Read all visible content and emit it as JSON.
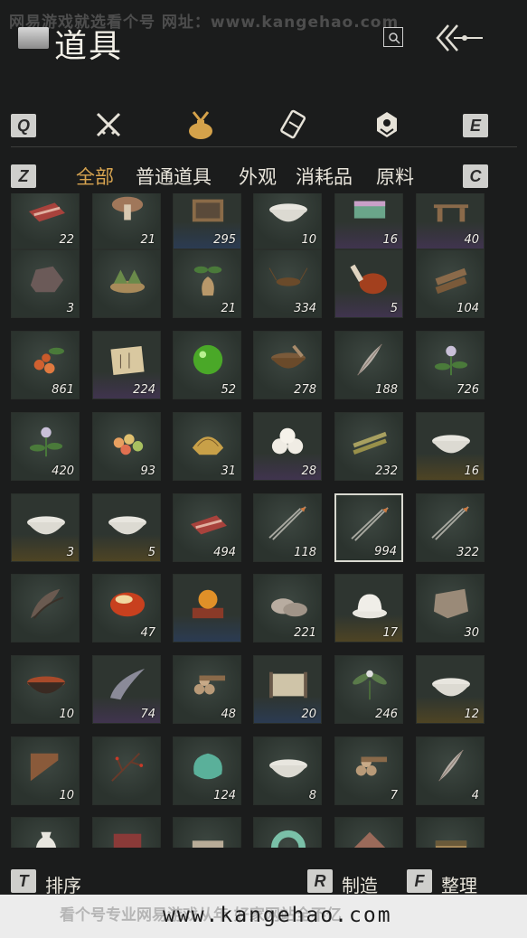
{
  "watermark": "网易游戏就选看个号    网址：www.kangehao.com",
  "header": {
    "title": "道具"
  },
  "keys": {
    "q": "Q",
    "e": "E",
    "z": "Z",
    "c": "C",
    "t": "T",
    "r": "R",
    "f": "F"
  },
  "tabs": [
    "crossed-swords-icon",
    "pouch-icon",
    "scroll-icon",
    "badge-icon"
  ],
  "subtabs": [
    "全部",
    "普通道具",
    "外观",
    "消耗品",
    "原料"
  ],
  "active_subtab": "全部",
  "items": [
    {
      "count": "22",
      "rarity": "none",
      "icon": "meat-icon"
    },
    {
      "count": "21",
      "rarity": "none",
      "icon": "mushroom-icon"
    },
    {
      "count": "295",
      "rarity": "blue",
      "icon": "box-icon"
    },
    {
      "count": "10",
      "rarity": "none",
      "icon": "bowl-icon"
    },
    {
      "count": "16",
      "rarity": "purple",
      "icon": "cake-icon"
    },
    {
      "count": "40",
      "rarity": "purple",
      "icon": "rack-icon"
    },
    {
      "count": "3",
      "rarity": "none",
      "icon": "ore-icon"
    },
    {
      "count": "",
      "rarity": "none",
      "icon": "dumplings-icon"
    },
    {
      "count": "21",
      "rarity": "none",
      "icon": "ginseng-icon"
    },
    {
      "count": "334",
      "rarity": "none",
      "icon": "cricket-icon"
    },
    {
      "count": "5",
      "rarity": "purple",
      "icon": "ham-icon"
    },
    {
      "count": "104",
      "rarity": "none",
      "icon": "wood-icon"
    },
    {
      "count": "861",
      "rarity": "none",
      "icon": "berries-icon"
    },
    {
      "count": "224",
      "rarity": "purple",
      "icon": "letter-icon"
    },
    {
      "count": "52",
      "rarity": "none",
      "icon": "jade-orb-icon"
    },
    {
      "count": "278",
      "rarity": "none",
      "icon": "mortar-icon"
    },
    {
      "count": "188",
      "rarity": "none",
      "icon": "feather-icon"
    },
    {
      "count": "726",
      "rarity": "none",
      "icon": "flower-icon"
    },
    {
      "count": "420",
      "rarity": "none",
      "icon": "flower-icon"
    },
    {
      "count": "93",
      "rarity": "none",
      "icon": "candy-icon"
    },
    {
      "count": "31",
      "rarity": "none",
      "icon": "gold-ingot-icon"
    },
    {
      "count": "28",
      "rarity": "purple",
      "icon": "buns-icon"
    },
    {
      "count": "232",
      "rarity": "none",
      "icon": "bamboo-icon"
    },
    {
      "count": "16",
      "rarity": "gold",
      "icon": "bowl-icon"
    },
    {
      "count": "3",
      "rarity": "gold",
      "icon": "bowl-icon"
    },
    {
      "count": "5",
      "rarity": "gold",
      "icon": "bowl-icon"
    },
    {
      "count": "494",
      "rarity": "none",
      "icon": "meat-icon"
    },
    {
      "count": "118",
      "rarity": "none",
      "icon": "arrows-icon"
    },
    {
      "count": "994",
      "rarity": "none",
      "icon": "arrows-icon"
    },
    {
      "count": "322",
      "rarity": "none",
      "icon": "arrows-icon"
    },
    {
      "count": "",
      "rarity": "none",
      "icon": "feathers-icon"
    },
    {
      "count": "47",
      "rarity": "none",
      "icon": "amber-icon"
    },
    {
      "count": "",
      "rarity": "blue",
      "icon": "orb-stand-icon"
    },
    {
      "count": "221",
      "rarity": "none",
      "icon": "oyster-icon"
    },
    {
      "count": "17",
      "rarity": "gold",
      "icon": "porcelain-icon"
    },
    {
      "count": "30",
      "rarity": "none",
      "icon": "pelt-icon"
    },
    {
      "count": "10",
      "rarity": "none",
      "icon": "soup-icon"
    },
    {
      "count": "74",
      "rarity": "purple",
      "icon": "horn-icon"
    },
    {
      "count": "48",
      "rarity": "none",
      "icon": "logs-icon"
    },
    {
      "count": "20",
      "rarity": "blue",
      "icon": "scroll-icon"
    },
    {
      "count": "246",
      "rarity": "none",
      "icon": "herb-icon"
    },
    {
      "count": "12",
      "rarity": "gold",
      "icon": "bowl-icon"
    },
    {
      "count": "10",
      "rarity": "none",
      "icon": "comb-icon"
    },
    {
      "count": "",
      "rarity": "none",
      "icon": "branch-icon"
    },
    {
      "count": "124",
      "rarity": "none",
      "icon": "jade-stone-icon"
    },
    {
      "count": "8",
      "rarity": "none",
      "icon": "bowl-icon"
    },
    {
      "count": "7",
      "rarity": "none",
      "icon": "logs-icon"
    },
    {
      "count": "4",
      "rarity": "none",
      "icon": "feather-icon"
    },
    {
      "count": "",
      "rarity": "none",
      "icon": "vase-icon"
    },
    {
      "count": "",
      "rarity": "none",
      "icon": "book-icon"
    },
    {
      "count": "",
      "rarity": "none",
      "icon": "tile-icon"
    },
    {
      "count": "",
      "rarity": "none",
      "icon": "jade-ring-icon"
    },
    {
      "count": "",
      "rarity": "none",
      "icon": "lantern-icon"
    },
    {
      "count": "",
      "rarity": "none",
      "icon": "chest-icon"
    }
  ],
  "selected_index": 28,
  "footer": {
    "sort": "排序",
    "craft": "制造",
    "organize": "整理"
  },
  "banner": {
    "url": "www.kangehao.com",
    "faint": "看个号专业网易游戏从年    好家网站全不亿"
  }
}
